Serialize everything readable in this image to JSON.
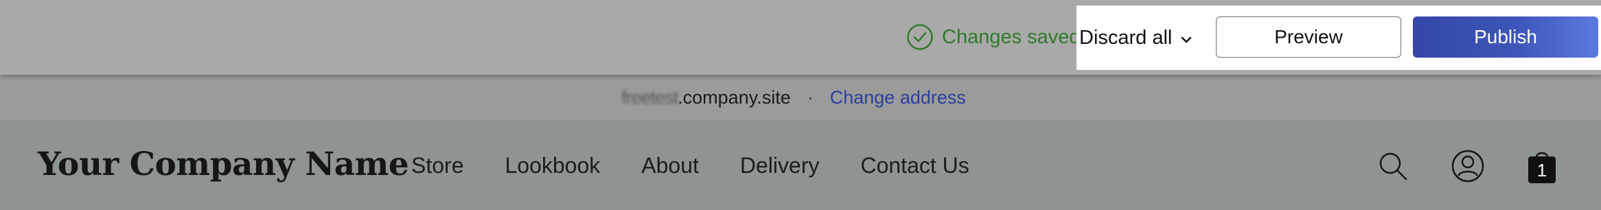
{
  "toolbar": {
    "status_text": "Changes saved",
    "discard_label": "Discard all",
    "preview_label": "Preview",
    "publish_label": "Publish"
  },
  "address": {
    "subdomain": "freetest",
    "domain": ".company.site",
    "separator": "·",
    "change_link": "Change address"
  },
  "site": {
    "logo": "Your Company Name",
    "nav": [
      "Store",
      "Lookbook",
      "About",
      "Delivery",
      "Contact Us"
    ],
    "cart_count": "1"
  },
  "colors": {
    "saved_green": "#2f7a2a",
    "publish_blue": "#3447a8",
    "link_blue": "#2b3f9e"
  },
  "icons": [
    "check-circle-icon",
    "chevron-down-icon",
    "search-icon",
    "account-icon",
    "cart-bag-icon"
  ]
}
